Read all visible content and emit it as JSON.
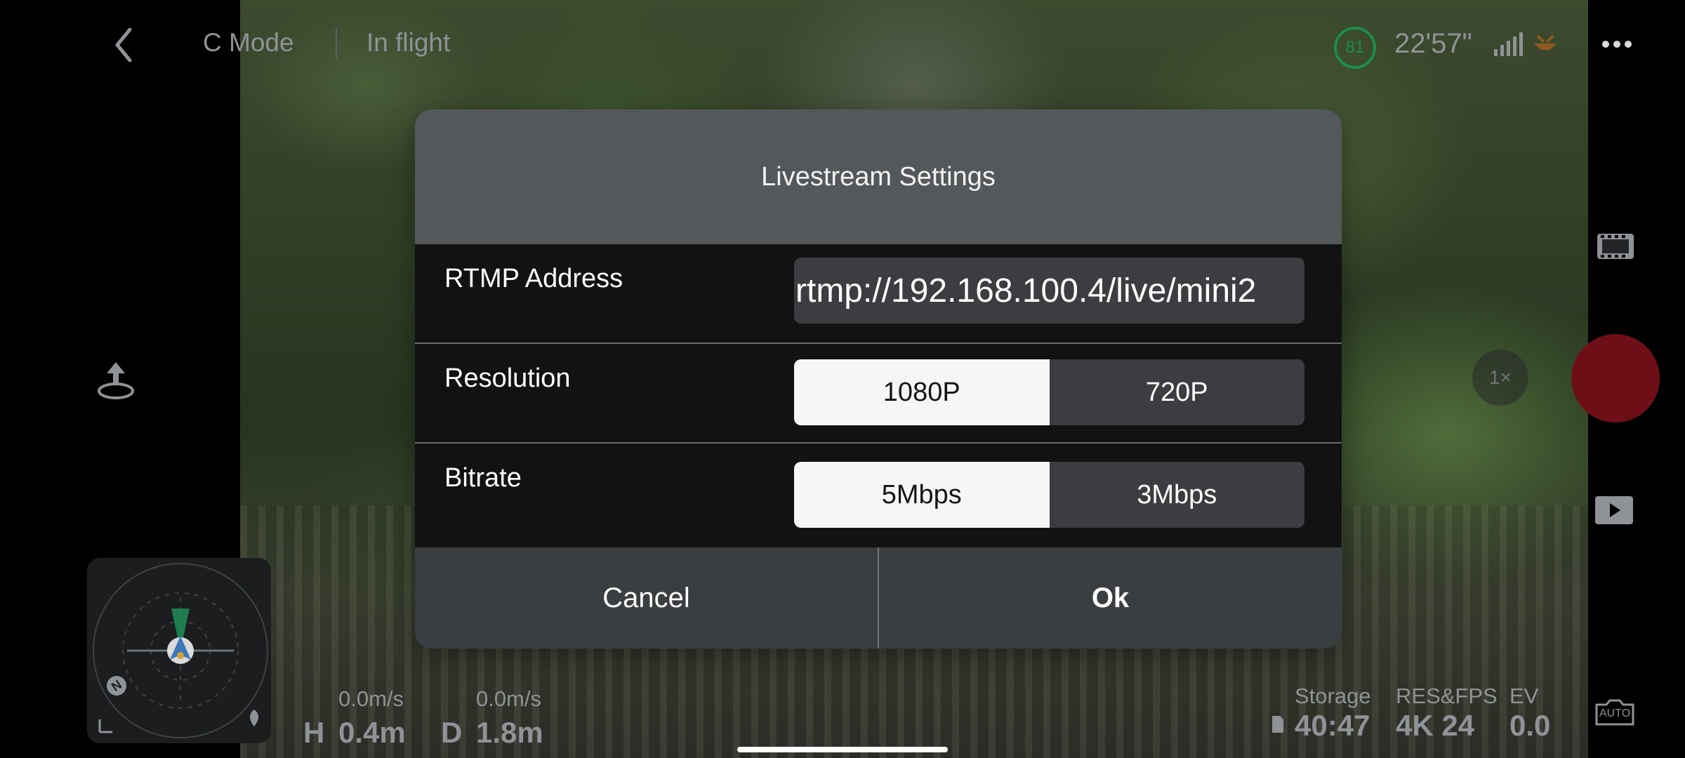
{
  "topbar": {
    "mode": "C Mode",
    "flight_status": "In flight",
    "battery_percent": "81",
    "flight_time": "22'57\""
  },
  "telemetry": {
    "horizontal_speed": "0.0m/s",
    "vertical_speed": "0.0m/s",
    "h_label": "H",
    "h_value": "0.4m",
    "d_label": "D",
    "d_value": "1.8m"
  },
  "compass": {
    "north_label": "N"
  },
  "camera_info": {
    "storage_label": "Storage",
    "storage_value": "40:47",
    "resfps_label": "RES&FPS",
    "resfps_value": "4K 24",
    "ev_label": "EV",
    "ev_value": "0.0"
  },
  "right_controls": {
    "zoom": "1×",
    "auto_label": "AUTO"
  },
  "dialog": {
    "title": "Livestream Settings",
    "rtmp_label": "RTMP Address",
    "rtmp_value": "rtmp://192.168.100.4/live/mini2",
    "resolution_label": "Resolution",
    "resolution_options": [
      "1080P",
      "720P"
    ],
    "resolution_selected": "1080P",
    "bitrate_label": "Bitrate",
    "bitrate_options": [
      "5Mbps",
      "3Mbps"
    ],
    "bitrate_selected": "5Mbps",
    "cancel_label": "Cancel",
    "ok_label": "Ok"
  },
  "icons": {
    "back": "back-chevron-icon",
    "takeoff": "takeoff-icon",
    "more": "more-icon",
    "film": "film-icon",
    "record": "record-button",
    "playback": "playback-icon",
    "camera_mode": "camera-auto-icon"
  },
  "colors": {
    "battery_green": "#1e8c4c",
    "record_red": "#6e0f18",
    "dialog_header": "#55585b",
    "dialog_body": "#121212",
    "dialog_footer": "#3b3e41",
    "segment_active": "#f5f6f7",
    "segment_inactive": "#3b3d40"
  }
}
